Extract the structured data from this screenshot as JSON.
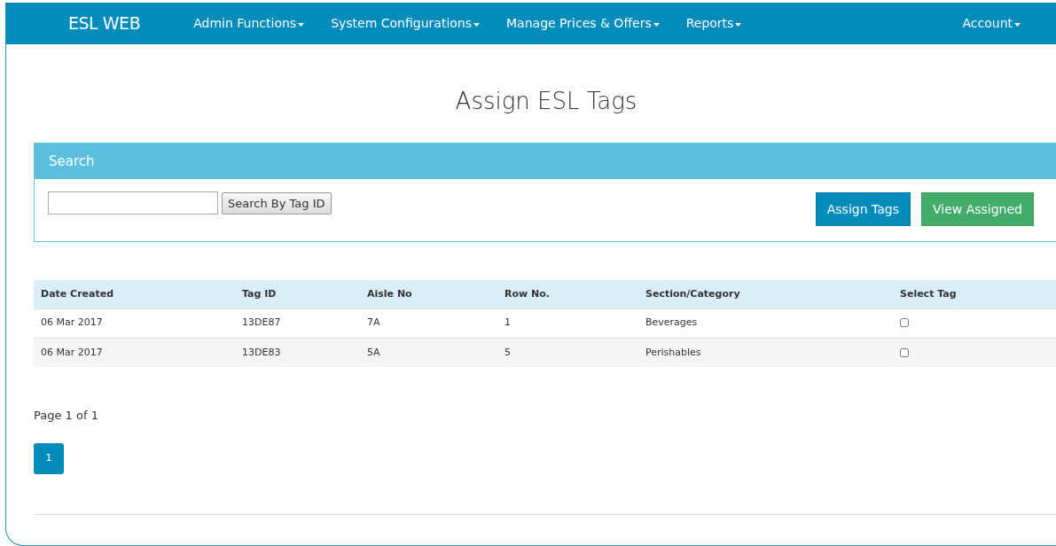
{
  "navbar": {
    "brand": "ESL WEB",
    "menus": [
      {
        "label": "Admin Functions"
      },
      {
        "label": "System Configurations"
      },
      {
        "label": "Manage Prices & Offers"
      },
      {
        "label": "Reports"
      }
    ],
    "account_menu": {
      "label": "Account"
    }
  },
  "page_title": "Assign ESL Tags",
  "search_panel": {
    "heading": "Search",
    "search_button": "Search By Tag ID",
    "buttons": [
      {
        "label": "Assign Tags",
        "kind": "primary"
      },
      {
        "label": "View Assigned",
        "kind": "success"
      }
    ]
  },
  "table": {
    "columns": [
      "Date Created",
      "Tag ID",
      "Aisle No",
      "Row No.",
      "Section/Category",
      "Select Tag"
    ],
    "rows": [
      {
        "cells": [
          "06 Mar 2017",
          "13DE87",
          "7A",
          "1",
          "Beverages"
        ],
        "checked": false
      },
      {
        "cells": [
          "06 Mar 2017",
          "13DE83",
          "5A",
          "5",
          "Perishables"
        ],
        "checked": false
      }
    ]
  },
  "pagination": {
    "summary": "Page 1 of 1",
    "pages": [
      {
        "label": "1",
        "selected": true
      }
    ]
  }
}
